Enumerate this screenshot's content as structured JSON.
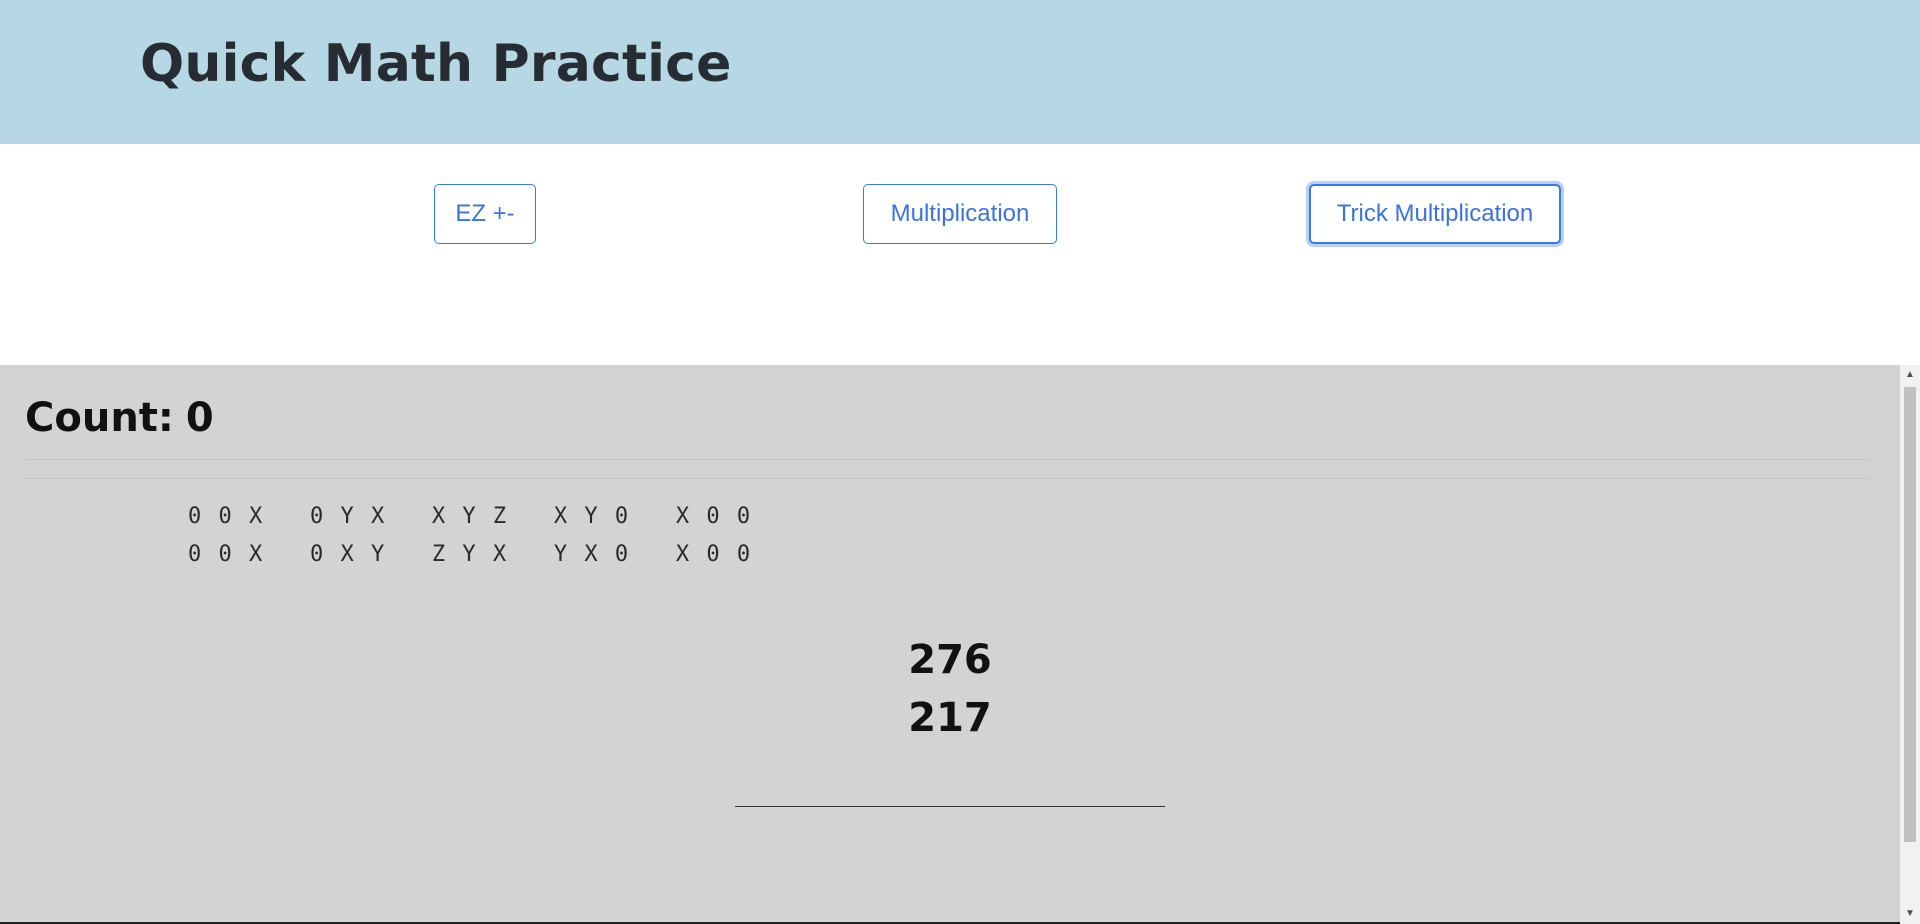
{
  "header": {
    "title": "Quick Math Practice"
  },
  "modes": [
    {
      "label": "EZ +-",
      "active": false
    },
    {
      "label": "Multiplication",
      "active": false
    },
    {
      "label": "Trick Multiplication",
      "active": true
    }
  ],
  "practice": {
    "count_label": "Count:",
    "count_value": "0",
    "pattern_rows": [
      "0 0 X   0 Y X   X Y Z   X Y 0   X 0 0",
      "0 0 X   0 X Y   Z Y X   Y X 0   X 0 0"
    ],
    "numbers": [
      "276",
      "217"
    ],
    "answer_value": ""
  },
  "colors": {
    "header_bg": "#b6d8e4",
    "practice_bg": "#d3d3d3",
    "accent": "#3b78e7"
  }
}
